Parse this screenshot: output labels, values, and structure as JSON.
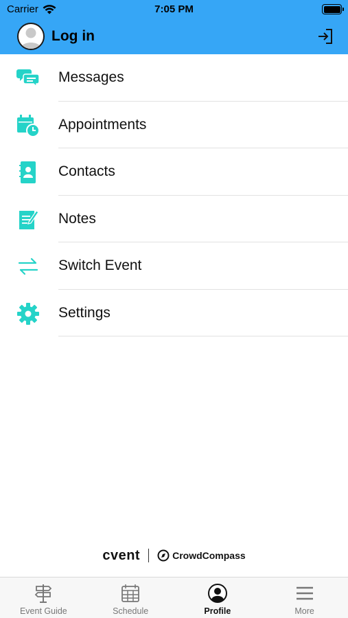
{
  "status_bar": {
    "carrier": "Carrier",
    "time": "7:05 PM"
  },
  "header": {
    "title": "Log in",
    "accent_color": "#36a6f6"
  },
  "menu": {
    "icon_color": "#25d3c8",
    "items": [
      {
        "label": "Messages",
        "icon": "chat-bubbles-icon"
      },
      {
        "label": "Appointments",
        "icon": "calendar-clock-icon"
      },
      {
        "label": "Contacts",
        "icon": "contact-book-icon"
      },
      {
        "label": "Notes",
        "icon": "note-edit-icon"
      },
      {
        "label": "Switch Event",
        "icon": "switch-arrows-icon"
      },
      {
        "label": "Settings",
        "icon": "gear-icon"
      }
    ]
  },
  "branding": {
    "left": "cvent",
    "right": "CrowdCompass"
  },
  "tabbar": {
    "active": "Profile",
    "tabs": [
      {
        "label": "Event Guide",
        "icon": "signpost-icon"
      },
      {
        "label": "Schedule",
        "icon": "calendar-grid-icon"
      },
      {
        "label": "Profile",
        "icon": "profile-icon"
      },
      {
        "label": "More",
        "icon": "hamburger-icon"
      }
    ]
  }
}
